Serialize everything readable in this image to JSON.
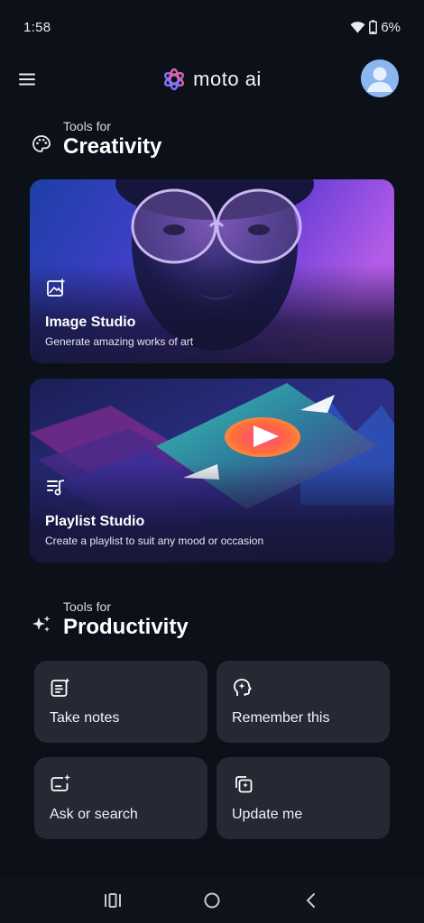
{
  "status": {
    "time": "1:58",
    "battery": "6%"
  },
  "app": {
    "brand": "moto ai"
  },
  "creativity": {
    "kicker": "Tools for",
    "title": "Creativity",
    "cards": [
      {
        "title": "Image Studio",
        "subtitle": "Generate amazing works of art",
        "icon": "image-sparkle-icon"
      },
      {
        "title": "Playlist Studio",
        "subtitle": "Create a playlist to suit any mood or occasion",
        "icon": "playlist-music-icon"
      }
    ]
  },
  "productivity": {
    "kicker": "Tools for",
    "title": "Productivity",
    "tiles": [
      {
        "label": "Take notes",
        "icon": "notes-sparkle-icon"
      },
      {
        "label": "Remember this",
        "icon": "head-sparkle-icon"
      },
      {
        "label": "Ask or search",
        "icon": "chat-sparkle-icon"
      },
      {
        "label": "Update me",
        "icon": "stack-sparkle-icon"
      }
    ]
  },
  "colors": {
    "background": "#0c1019",
    "tile": "#252933",
    "accent_purple": "#a36cf0",
    "accent_blue": "#3a6fd8"
  }
}
